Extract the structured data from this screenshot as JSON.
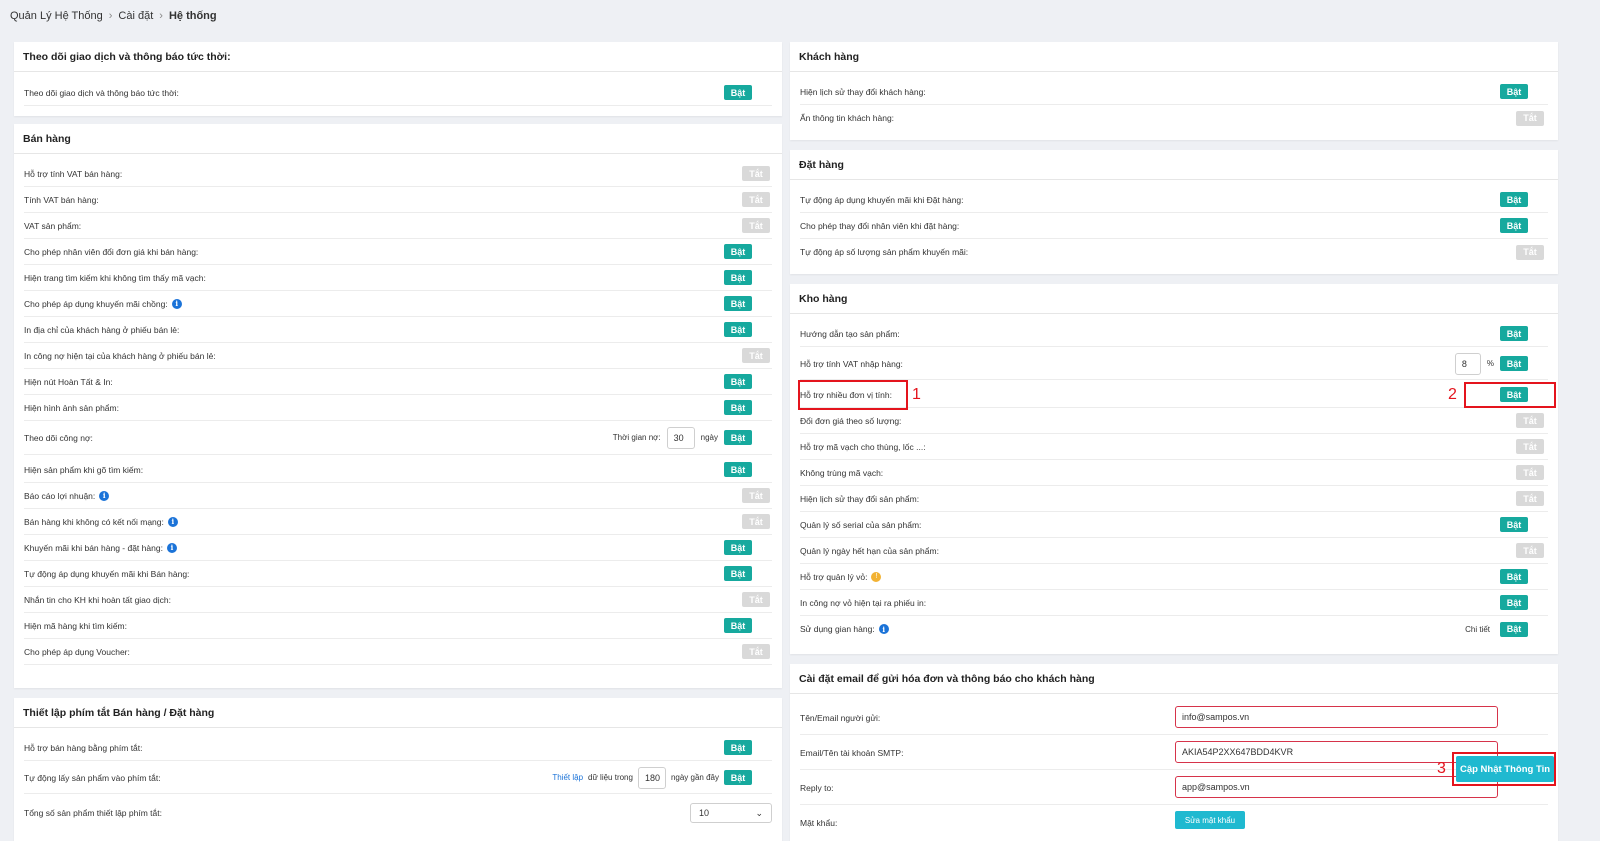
{
  "breadcrumb": {
    "item1": "Quản Lý Hệ Thống",
    "item2": "Cài đặt",
    "current": "Hệ thống"
  },
  "toggle_labels": {
    "on": "Bật",
    "off": "Tắt"
  },
  "realtime": {
    "title": "Theo dõi giao dịch và thông báo tức thời:",
    "row_label": "Theo dõi giao dịch và thông báo tức thời:"
  },
  "sales": {
    "title": "Bán hàng",
    "rows": [
      "Hỗ trợ tính VAT bán hàng:",
      "Tính VAT bán hàng:",
      "VAT sản phẩm:",
      "Cho phép nhân viên đổi đơn giá khi bán hàng:",
      "Hiện trang tìm kiếm khi không tìm thấy mã vạch:",
      "Cho phép áp dụng khuyến mãi chồng:",
      "In địa chỉ của khách hàng ở phiếu bán lẻ:",
      "In công nợ hiện tại của khách hàng ở phiếu bán lẻ:",
      "Hiện nút Hoàn Tất & In:",
      "Hiện hình ảnh sản phẩm:",
      "Theo dõi công nợ:",
      "Hiện sản phẩm khi gõ tìm kiếm:",
      "Báo cáo lợi nhuận:",
      "Bán hàng khi không có kết nối mạng:",
      "Khuyến mãi khi bán hàng - đặt hàng:",
      "Tự động áp dụng khuyến mãi khi Bán hàng:",
      "Nhắn tin cho KH khi hoàn tất giao dịch:",
      "Hiện mã hàng khi tìm kiếm:",
      "Cho phép áp dụng Voucher:"
    ],
    "debt_time_label": "Thời gian nợ:",
    "debt_days": "30",
    "debt_unit": "ngày"
  },
  "shortcuts": {
    "title": "Thiết lập phím tắt Bán hàng / Đặt hàng",
    "row1": "Hỗ trợ bán hàng bằng phím tắt:",
    "row2": "Tự động lấy sản phẩm vào phím tắt:",
    "row3": "Tổng số sản phẩm thiết lập phím tắt:",
    "setup_link": "Thiết lập",
    "data_in": "dữ liệu trong",
    "days_value": "180",
    "recent_days": "ngày gần đây",
    "total_value": "10"
  },
  "customers": {
    "title": "Khách hàng",
    "row1": "Hiện lịch sử thay đổi khách hàng:",
    "row2": "Ẩn thông tin khách hàng:"
  },
  "orders": {
    "title": "Đặt hàng",
    "row1": "Tự động áp dụng khuyến mãi khi Đặt hàng:",
    "row2": "Cho phép thay đổi nhân viên khi đặt hàng:",
    "row3": "Tự động áp số lượng sản phẩm khuyến mãi:"
  },
  "warehouse": {
    "title": "Kho hàng",
    "rows": [
      "Hướng dẫn tạo sản phẩm:",
      "Hỗ trợ tính VAT nhập hàng:",
      "Hỗ trợ nhiều đơn vị tính:",
      "Đổi đơn giá theo số lượng:",
      "Hỗ trợ mã vạch cho thùng, lốc ...:",
      "Không trùng mã vạch:",
      "Hiện lịch sử thay đổi sản phẩm:",
      "Quản lý số serial của sản phẩm:",
      "Quản lý ngày hết hạn của sản phẩm:",
      "Hỗ trợ quản lý vỏ:",
      "In công nợ vỏ hiện tại ra phiếu in:",
      "Sử dụng gian hàng:"
    ],
    "vat_value": "8",
    "vat_unit": "%",
    "detail_link": "Chi tiết"
  },
  "email": {
    "title": "Cài đặt email để gửi hóa đơn và thông báo cho khách hàng",
    "sender_label": "Tên/Email người gửi:",
    "sender_value": "info@sampos.vn",
    "smtp_label": "Email/Tên tài khoản SMTP:",
    "smtp_value": "AKIA54P2XX647BDD4KVR",
    "reply_label": "Reply to:",
    "reply_value": "app@sampos.vn",
    "password_label": "Mật khẩu:",
    "change_password_btn": "Sửa mật khẩu",
    "update_btn": "Cập Nhật Thông Tin"
  },
  "annotations": {
    "m1": "1",
    "m2": "2",
    "m3": "3"
  }
}
